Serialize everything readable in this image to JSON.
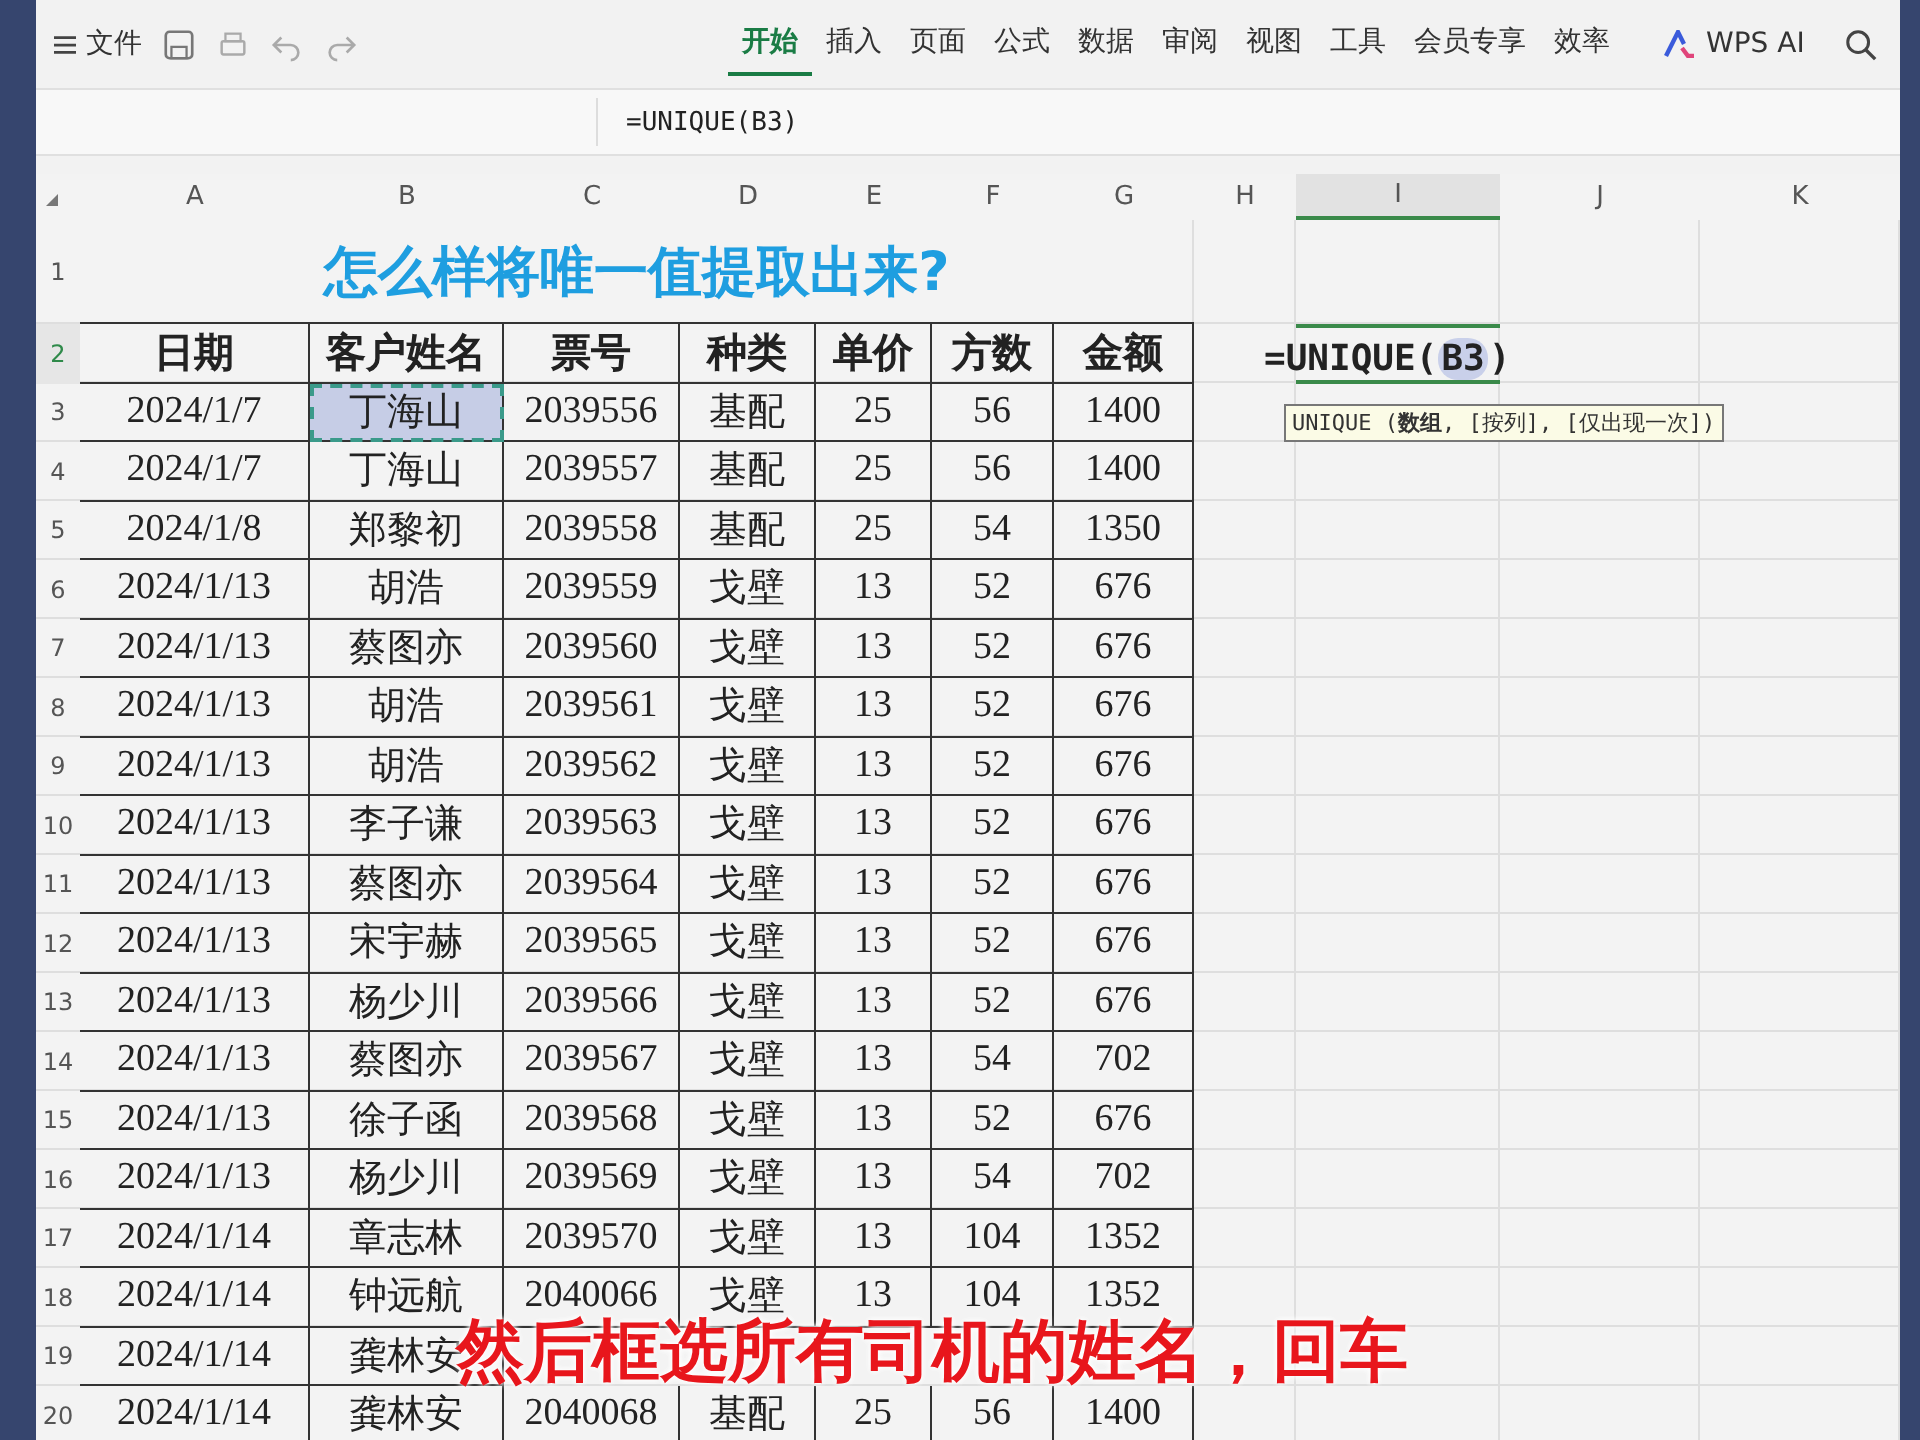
{
  "toolbar": {
    "file_menu": "文件",
    "tabs": [
      {
        "label": "开始",
        "selected": true
      },
      {
        "label": "插入",
        "selected": false
      },
      {
        "label": "页面",
        "selected": false
      },
      {
        "label": "公式",
        "selected": false
      },
      {
        "label": "数据",
        "selected": false
      },
      {
        "label": "审阅",
        "selected": false
      },
      {
        "label": "视图",
        "selected": false
      },
      {
        "label": "工具",
        "selected": false
      },
      {
        "label": "会员专享",
        "selected": false
      },
      {
        "label": "效率",
        "selected": false
      }
    ],
    "ai_button": "WPS AI"
  },
  "formula_bar": {
    "formula": "=UNIQUE(B3)"
  },
  "sheet": {
    "columns": [
      {
        "label": "A",
        "selected": false
      },
      {
        "label": "B",
        "selected": false
      },
      {
        "label": "C",
        "selected": false
      },
      {
        "label": "D",
        "selected": false
      },
      {
        "label": "E",
        "selected": false
      },
      {
        "label": "F",
        "selected": false
      },
      {
        "label": "G",
        "selected": false
      },
      {
        "label": "H",
        "selected": false
      },
      {
        "label": "I",
        "selected": true
      },
      {
        "label": "J",
        "selected": false
      },
      {
        "label": "K",
        "selected": false
      }
    ],
    "rows": [
      {
        "label": "1",
        "selected": false
      },
      {
        "label": "2",
        "selected": true
      },
      {
        "label": "3",
        "selected": false
      },
      {
        "label": "4",
        "selected": false
      },
      {
        "label": "5",
        "selected": false
      },
      {
        "label": "6",
        "selected": false
      },
      {
        "label": "7",
        "selected": false
      },
      {
        "label": "8",
        "selected": false
      },
      {
        "label": "9",
        "selected": false
      },
      {
        "label": "10",
        "selected": false
      },
      {
        "label": "11",
        "selected": false
      },
      {
        "label": "12",
        "selected": false
      },
      {
        "label": "13",
        "selected": false
      },
      {
        "label": "14",
        "selected": false
      },
      {
        "label": "15",
        "selected": false
      },
      {
        "label": "16",
        "selected": false
      },
      {
        "label": "17",
        "selected": false
      },
      {
        "label": "18",
        "selected": false
      },
      {
        "label": "19",
        "selected": false
      },
      {
        "label": "20",
        "selected": false
      }
    ],
    "title": "怎么样将唯一值提取出来?",
    "header": [
      "日期",
      "客户姓名",
      "票号",
      "种类",
      "单价",
      "方数",
      "金额"
    ],
    "data": [
      [
        {
          "t": "2024/1/7",
          "selected": false
        },
        {
          "t": "丁海山",
          "selected": true
        },
        {
          "t": "2039556",
          "selected": false
        },
        {
          "t": "基配",
          "selected": false
        },
        {
          "t": "25",
          "selected": false
        },
        {
          "t": "56",
          "selected": false
        },
        {
          "t": "1400",
          "selected": false
        }
      ],
      [
        {
          "t": "2024/1/7",
          "selected": false
        },
        {
          "t": "丁海山",
          "selected": false
        },
        {
          "t": "2039557",
          "selected": false
        },
        {
          "t": "基配",
          "selected": false
        },
        {
          "t": "25",
          "selected": false
        },
        {
          "t": "56",
          "selected": false
        },
        {
          "t": "1400",
          "selected": false
        }
      ],
      [
        {
          "t": "2024/1/8",
          "selected": false
        },
        {
          "t": "郑黎初",
          "selected": false
        },
        {
          "t": "2039558",
          "selected": false
        },
        {
          "t": "基配",
          "selected": false
        },
        {
          "t": "25",
          "selected": false
        },
        {
          "t": "54",
          "selected": false
        },
        {
          "t": "1350",
          "selected": false
        }
      ],
      [
        {
          "t": "2024/1/13",
          "selected": false
        },
        {
          "t": "胡浩",
          "selected": false
        },
        {
          "t": "2039559",
          "selected": false
        },
        {
          "t": "戈壁",
          "selected": false
        },
        {
          "t": "13",
          "selected": false
        },
        {
          "t": "52",
          "selected": false
        },
        {
          "t": "676",
          "selected": false
        }
      ],
      [
        {
          "t": "2024/1/13",
          "selected": false
        },
        {
          "t": "蔡图亦",
          "selected": false
        },
        {
          "t": "2039560",
          "selected": false
        },
        {
          "t": "戈壁",
          "selected": false
        },
        {
          "t": "13",
          "selected": false
        },
        {
          "t": "52",
          "selected": false
        },
        {
          "t": "676",
          "selected": false
        }
      ],
      [
        {
          "t": "2024/1/13",
          "selected": false
        },
        {
          "t": "胡浩",
          "selected": false
        },
        {
          "t": "2039561",
          "selected": false
        },
        {
          "t": "戈壁",
          "selected": false
        },
        {
          "t": "13",
          "selected": false
        },
        {
          "t": "52",
          "selected": false
        },
        {
          "t": "676",
          "selected": false
        }
      ],
      [
        {
          "t": "2024/1/13",
          "selected": false
        },
        {
          "t": "胡浩",
          "selected": false
        },
        {
          "t": "2039562",
          "selected": false
        },
        {
          "t": "戈壁",
          "selected": false
        },
        {
          "t": "13",
          "selected": false
        },
        {
          "t": "52",
          "selected": false
        },
        {
          "t": "676",
          "selected": false
        }
      ],
      [
        {
          "t": "2024/1/13",
          "selected": false
        },
        {
          "t": "李子谦",
          "selected": false
        },
        {
          "t": "2039563",
          "selected": false
        },
        {
          "t": "戈壁",
          "selected": false
        },
        {
          "t": "13",
          "selected": false
        },
        {
          "t": "52",
          "selected": false
        },
        {
          "t": "676",
          "selected": false
        }
      ],
      [
        {
          "t": "2024/1/13",
          "selected": false
        },
        {
          "t": "蔡图亦",
          "selected": false
        },
        {
          "t": "2039564",
          "selected": false
        },
        {
          "t": "戈壁",
          "selected": false
        },
        {
          "t": "13",
          "selected": false
        },
        {
          "t": "52",
          "selected": false
        },
        {
          "t": "676",
          "selected": false
        }
      ],
      [
        {
          "t": "2024/1/13",
          "selected": false
        },
        {
          "t": "宋宇赫",
          "selected": false
        },
        {
          "t": "2039565",
          "selected": false
        },
        {
          "t": "戈壁",
          "selected": false
        },
        {
          "t": "13",
          "selected": false
        },
        {
          "t": "52",
          "selected": false
        },
        {
          "t": "676",
          "selected": false
        }
      ],
      [
        {
          "t": "2024/1/13",
          "selected": false
        },
        {
          "t": "杨少川",
          "selected": false
        },
        {
          "t": "2039566",
          "selected": false
        },
        {
          "t": "戈壁",
          "selected": false
        },
        {
          "t": "13",
          "selected": false
        },
        {
          "t": "52",
          "selected": false
        },
        {
          "t": "676",
          "selected": false
        }
      ],
      [
        {
          "t": "2024/1/13",
          "selected": false
        },
        {
          "t": "蔡图亦",
          "selected": false
        },
        {
          "t": "2039567",
          "selected": false
        },
        {
          "t": "戈壁",
          "selected": false
        },
        {
          "t": "13",
          "selected": false
        },
        {
          "t": "54",
          "selected": false
        },
        {
          "t": "702",
          "selected": false
        }
      ],
      [
        {
          "t": "2024/1/13",
          "selected": false
        },
        {
          "t": "徐子函",
          "selected": false
        },
        {
          "t": "2039568",
          "selected": false
        },
        {
          "t": "戈壁",
          "selected": false
        },
        {
          "t": "13",
          "selected": false
        },
        {
          "t": "52",
          "selected": false
        },
        {
          "t": "676",
          "selected": false
        }
      ],
      [
        {
          "t": "2024/1/13",
          "selected": false
        },
        {
          "t": "杨少川",
          "selected": false
        },
        {
          "t": "2039569",
          "selected": false
        },
        {
          "t": "戈壁",
          "selected": false
        },
        {
          "t": "13",
          "selected": false
        },
        {
          "t": "54",
          "selected": false
        },
        {
          "t": "702",
          "selected": false
        }
      ],
      [
        {
          "t": "2024/1/14",
          "selected": false
        },
        {
          "t": "章志林",
          "selected": false
        },
        {
          "t": "2039570",
          "selected": false
        },
        {
          "t": "戈壁",
          "selected": false
        },
        {
          "t": "13",
          "selected": false
        },
        {
          "t": "104",
          "selected": false
        },
        {
          "t": "1352",
          "selected": false
        }
      ],
      [
        {
          "t": "2024/1/14",
          "selected": false
        },
        {
          "t": "钟远航",
          "selected": false
        },
        {
          "t": "2040066",
          "selected": false
        },
        {
          "t": "戈壁",
          "selected": false
        },
        {
          "t": "13",
          "selected": false
        },
        {
          "t": "104",
          "selected": false
        },
        {
          "t": "1352",
          "selected": false
        }
      ],
      [
        {
          "t": "2024/1/14",
          "selected": false
        },
        {
          "t": "龚林安",
          "selected": false
        }
      ],
      [
        {
          "t": "2024/1/14",
          "selected": false
        },
        {
          "t": "龚林安",
          "selected": false
        },
        {
          "t": "2040068",
          "selected": false
        },
        {
          "t": "基配",
          "selected": false
        },
        {
          "t": "25",
          "selected": false
        },
        {
          "t": "56",
          "selected": false
        },
        {
          "t": "1400",
          "selected": false
        }
      ]
    ],
    "editor": {
      "prefix": "=UNIQUE(",
      "reference": "B3",
      "suffix": ")",
      "hint": "UNIQUE (**数组**, [按列], [仅出现一次])"
    }
  },
  "caption": "然后框选所有司机的姓名，回车"
}
